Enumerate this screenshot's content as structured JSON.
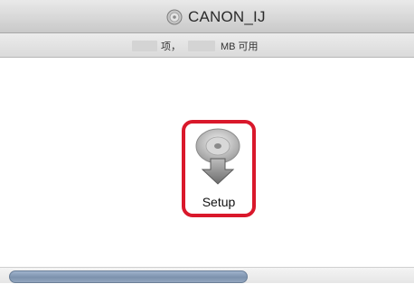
{
  "window": {
    "title": "CANON_IJ",
    "title_icon": "disc-icon"
  },
  "statusbar": {
    "items_suffix": "项，",
    "space_suffix": "MB 可用"
  },
  "content": {
    "items": [
      {
        "label": "Setup",
        "icon": "installer-disc-icon",
        "highlighted": true,
        "highlight_color": "#d9182b"
      }
    ]
  },
  "scrollbar": {
    "visible": true
  }
}
